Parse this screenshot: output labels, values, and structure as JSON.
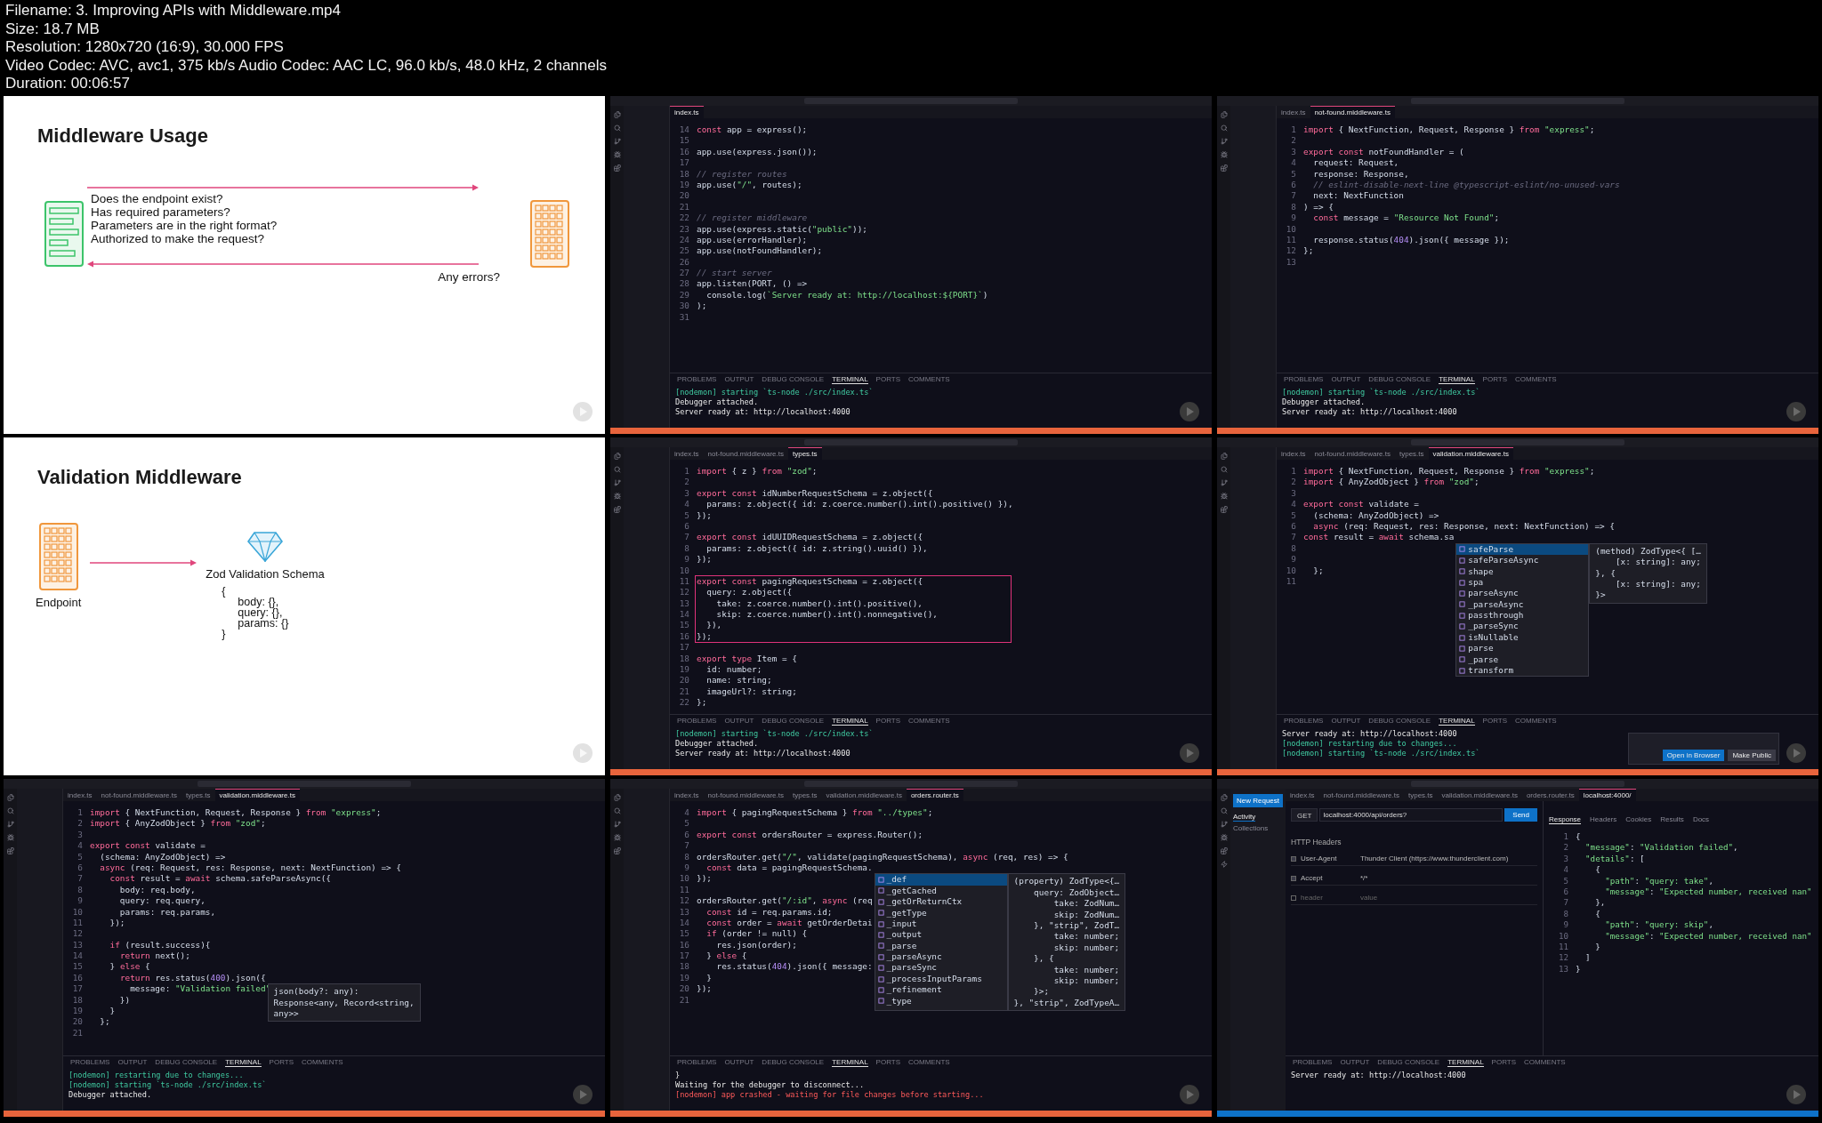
{
  "header": [
    "Filename: 3. Improving APIs with Middleware.mp4",
    "Size: 18.7 MB",
    "Resolution: 1280x720 (16:9), 30.000 FPS",
    "Video Codec: AVC, avc1, 375 kb/s Audio Codec: AAC LC, 96.0 kb/s, 48.0 kHz, 2 channels",
    "Duration: 00:06:57"
  ],
  "tiles": [
    {
      "kind": "flow_slide",
      "title": "Middleware Usage",
      "questions": [
        "Does the endpoint exist?",
        "Has required parameters?",
        "Parameters are in the right format?",
        "Authorized to make the request?"
      ],
      "caption": "Any errors?"
    },
    {
      "kind": "editor",
      "status_bar": {
        "color": "#e8643c"
      },
      "tabs": [
        {
          "label": "index.ts",
          "selected": true
        }
      ],
      "lines": [
        {
          "n": "14",
          "text": "const app = express();"
        },
        {
          "n": "15"
        },
        {
          "n": "16",
          "text": "app.use(express.json());"
        },
        {
          "n": "17"
        },
        {
          "n": "18",
          "text": "// register routes"
        },
        {
          "n": "19",
          "text": "app.use(\"/\", routes);"
        },
        {
          "n": "20"
        },
        {
          "n": "21"
        },
        {
          "n": "22",
          "text": "// register middleware"
        },
        {
          "n": "23",
          "text": "app.use(express.static(\"public\"));"
        },
        {
          "n": "24",
          "text": "app.use(errorHandler);"
        },
        {
          "n": "25",
          "text": "app.use(notFoundHandler);"
        },
        {
          "n": "26"
        },
        {
          "n": "27",
          "text": "// start server"
        },
        {
          "n": "28",
          "text": "app.listen(PORT, () =>"
        },
        {
          "n": "29",
          "text": "  console.log(`Server ready at: http://localhost:${PORT}`)"
        },
        {
          "n": "30",
          "text": ");"
        },
        {
          "n": "31"
        }
      ],
      "panel_tabs": [
        {
          "label": "PROBLEMS",
          "selected": false
        },
        {
          "label": "OUTPUT",
          "selected": false
        },
        {
          "label": "DEBUG CONSOLE",
          "selected": false
        },
        {
          "label": "TERMINAL",
          "selected": true
        },
        {
          "label": "PORTS",
          "selected": false
        },
        {
          "label": "COMMENTS",
          "selected": false
        }
      ],
      "terminal": [
        {
          "kind": "info",
          "text": "[nodemon] starting `ts-node ./src/index.ts`"
        },
        {
          "kind": "plain",
          "text": "Debugger attached."
        },
        {
          "kind": "plain",
          "text": "Server ready at: http://localhost:4000"
        }
      ]
    },
    {
      "kind": "editor",
      "status_bar": {
        "color": "#e8643c"
      },
      "tabs": [
        {
          "label": "index.ts",
          "selected": false
        },
        {
          "label": "not-found.middleware.ts",
          "selected": true
        }
      ],
      "lines": [
        {
          "n": "1",
          "text": "import { NextFunction, Request, Response } from \"express\";"
        },
        {
          "n": "2"
        },
        {
          "n": "3",
          "text": "export const notFoundHandler = ("
        },
        {
          "n": "4",
          "text": "  request: Request,"
        },
        {
          "n": "5",
          "text": "  response: Response,"
        },
        {
          "n": "6",
          "text": "  // eslint-disable-next-line @typescript-eslint/no-unused-vars"
        },
        {
          "n": "7",
          "text": "  next: NextFunction"
        },
        {
          "n": "8",
          "text": ") => {"
        },
        {
          "n": "9",
          "text": "  const message = \"Resource Not Found\";"
        },
        {
          "n": "10"
        },
        {
          "n": "11",
          "text": "  response.status(404).json({ message });"
        },
        {
          "n": "12",
          "text": "};"
        },
        {
          "n": "13"
        }
      ],
      "panel_tabs": [
        {
          "label": "PROBLEMS",
          "selected": false
        },
        {
          "label": "OUTPUT",
          "selected": false
        },
        {
          "label": "DEBUG CONSOLE",
          "selected": false
        },
        {
          "label": "TERMINAL",
          "selected": true
        },
        {
          "label": "PORTS",
          "selected": false
        },
        {
          "label": "COMMENTS",
          "selected": false
        }
      ],
      "terminal": [
        {
          "kind": "info",
          "text": "[nodemon] starting `ts-node ./src/index.ts`"
        },
        {
          "kind": "plain",
          "text": "Debugger attached."
        },
        {
          "kind": "plain",
          "text": "Server ready at: http://localhost:4000"
        }
      ]
    },
    {
      "kind": "schema_slide",
      "title": "Validation Middleware",
      "endpoint": "Endpoint",
      "schema": "Zod Validation Schema",
      "object_lines": [
        "{",
        "body: {},",
        "query: {},",
        "params: {}",
        "}"
      ]
    },
    {
      "kind": "editor",
      "status_bar": {
        "color": "#e8643c"
      },
      "tabs": [
        {
          "label": "index.ts",
          "selected": false
        },
        {
          "label": "not-found.middleware.ts",
          "selected": false
        },
        {
          "label": "types.ts",
          "selected": true
        }
      ],
      "lines": [
        {
          "n": "1",
          "text": "import { z } from \"zod\";"
        },
        {
          "n": "2"
        },
        {
          "n": "3",
          "text": "export const idNumberRequestSchema = z.object({"
        },
        {
          "n": "4",
          "text": "  params: z.object({ id: z.coerce.number().int().positive() }),"
        },
        {
          "n": "5",
          "text": "});"
        },
        {
          "n": "6"
        },
        {
          "n": "7",
          "text": "export const idUUIDRequestSchema = z.object({"
        },
        {
          "n": "8",
          "text": "  params: z.object({ id: z.string().uuid() }),"
        },
        {
          "n": "9",
          "text": "});"
        },
        {
          "n": "10"
        },
        {
          "n": "11",
          "text": "export const pagingRequestSchema = z.object({",
          "boxed": true
        },
        {
          "n": "12",
          "text": "  query: z.object({",
          "boxed": true
        },
        {
          "n": "13",
          "text": "    take: z.coerce.number().int().positive(),",
          "boxed": true
        },
        {
          "n": "14",
          "text": "    skip: z.coerce.number().int().nonnegative(),",
          "boxed": true
        },
        {
          "n": "15",
          "text": "  }),",
          "boxed": true
        },
        {
          "n": "16",
          "text": "});",
          "boxed": true
        },
        {
          "n": "17"
        },
        {
          "n": "18",
          "text": "export type Item = {"
        },
        {
          "n": "19",
          "text": "  id: number;"
        },
        {
          "n": "20",
          "text": "  name: string;"
        },
        {
          "n": "21",
          "text": "  imageUrl?: string;"
        },
        {
          "n": "22",
          "text": "};"
        }
      ],
      "panel_tabs": [
        {
          "label": "PROBLEMS",
          "selected": false
        },
        {
          "label": "OUTPUT",
          "selected": false
        },
        {
          "label": "DEBUG CONSOLE",
          "selected": false
        },
        {
          "label": "TERMINAL",
          "selected": true
        },
        {
          "label": "PORTS",
          "selected": false
        },
        {
          "label": "COMMENTS",
          "selected": false
        }
      ],
      "terminal": [
        {
          "kind": "info",
          "text": "[nodemon] starting `ts-node ./src/index.ts`"
        },
        {
          "kind": "plain",
          "text": "Debugger attached."
        },
        {
          "kind": "plain",
          "text": "Server ready at: http://localhost:4000"
        }
      ]
    },
    {
      "kind": "editor",
      "status_bar": {
        "color": "#e8643c"
      },
      "tabs": [
        {
          "label": "index.ts",
          "selected": false
        },
        {
          "label": "not-found.middleware.ts",
          "selected": false
        },
        {
          "label": "types.ts",
          "selected": false
        },
        {
          "label": "validation.middleware.ts",
          "selected": true
        }
      ],
      "lines": [
        {
          "n": "1",
          "text": "import { NextFunction, Request, Response } from \"express\";"
        },
        {
          "n": "2",
          "text": "import { AnyZodObject } from \"zod\";"
        },
        {
          "n": "3"
        },
        {
          "n": "4",
          "text": "export const validate ="
        },
        {
          "n": "5",
          "text": "  (schema: AnyZodObject) =>"
        },
        {
          "n": "6",
          "text": "  async (req: Request, res: Response, next: NextFunction) => {"
        },
        {
          "n": "7",
          "text": "const result = await schema.sa",
          "popup": {
            "kind": "completion",
            "items": [
              {
                "label": "safeParse",
                "selected": true
              },
              {
                "label": "safeParseAsync",
                "selected": false
              },
              {
                "label": "shape",
                "selected": false
              },
              {
                "label": "spa",
                "selected": false
              },
              {
                "label": "parseAsync",
                "selected": false
              },
              {
                "label": "_parseAsync",
                "selected": false
              },
              {
                "label": "passthrough",
                "selected": false
              },
              {
                "label": "_parseSync",
                "selected": false
              },
              {
                "label": "isNullable",
                "selected": false
              },
              {
                "label": "parse",
                "selected": false
              },
              {
                "label": "_parse",
                "selected": false
              },
              {
                "label": "transform",
                "selected": false
              }
            ],
            "detail": [
              "(method) ZodType<{ […",
              "    [x: string]: any;",
              "}, {",
              "    [x: string]: any;",
              "}>"
            ]
          }
        },
        {
          "n": "8"
        },
        {
          "n": "9"
        },
        {
          "n": "10",
          "text": "  };"
        },
        {
          "n": "11"
        }
      ],
      "panel_tabs": [
        {
          "label": "PROBLEMS",
          "selected": false
        },
        {
          "label": "OUTPUT",
          "selected": false
        },
        {
          "label": "DEBUG CONSOLE",
          "selected": false
        },
        {
          "label": "TERMINAL",
          "selected": true
        },
        {
          "label": "PORTS",
          "selected": false
        },
        {
          "label": "COMMENTS",
          "selected": false
        }
      ],
      "terminal": [
        {
          "kind": "plain",
          "text": "Server ready at: http://localhost:4000"
        },
        {
          "kind": "info",
          "text": "[nodemon] restarting due to changes..."
        },
        {
          "kind": "info",
          "text": "[nodemon] starting `ts-node ./src/index.ts`"
        }
      ],
      "toast": {
        "buttons": [
          "Open in Browser",
          "Make Public"
        ]
      }
    },
    {
      "kind": "editor",
      "status_bar": {
        "color": "#e8643c"
      },
      "tabs": [
        {
          "label": "index.ts",
          "selected": false
        },
        {
          "label": "not-found.middleware.ts",
          "selected": false
        },
        {
          "label": "types.ts",
          "selected": false
        },
        {
          "label": "validation.middleware.ts",
          "selected": true
        }
      ],
      "lines": [
        {
          "n": "1",
          "text": "import { NextFunction, Request, Response } from \"express\";"
        },
        {
          "n": "2",
          "text": "import { AnyZodObject } from \"zod\";"
        },
        {
          "n": "3"
        },
        {
          "n": "4",
          "text": "export const validate ="
        },
        {
          "n": "5",
          "text": "  (schema: AnyZodObject) =>"
        },
        {
          "n": "6",
          "text": "  async (req: Request, res: Response, next: NextFunction) => {"
        },
        {
          "n": "7",
          "text": "    const result = await schema.safeParseAsync({"
        },
        {
          "n": "8",
          "text": "      body: req.body,"
        },
        {
          "n": "9",
          "text": "      query: req.query,"
        },
        {
          "n": "10",
          "text": "      params: req.params,"
        },
        {
          "n": "11",
          "text": "    });"
        },
        {
          "n": "12"
        },
        {
          "n": "13",
          "text": "    if (result.success){"
        },
        {
          "n": "14",
          "text": "      return next();"
        },
        {
          "n": "15",
          "text": "    } else {"
        },
        {
          "n": "16",
          "text": "      return res.status(400).json({",
          "popup": {
            "kind": "hint",
            "detail": [
              "json(body?: any):",
              "Response<any, Record<string,",
              "any>>"
            ]
          }
        },
        {
          "n": "17",
          "text": "        message: \"Validation failed\""
        },
        {
          "n": "18",
          "text": "      })"
        },
        {
          "n": "19",
          "text": "    }"
        },
        {
          "n": "20",
          "text": "  };"
        },
        {
          "n": "21"
        }
      ],
      "panel_tabs": [
        {
          "label": "PROBLEMS",
          "selected": false
        },
        {
          "label": "OUTPUT",
          "selected": false
        },
        {
          "label": "DEBUG CONSOLE",
          "selected": false
        },
        {
          "label": "TERMINAL",
          "selected": true
        },
        {
          "label": "PORTS",
          "selected": false
        },
        {
          "label": "COMMENTS",
          "selected": false
        }
      ],
      "terminal": [
        {
          "kind": "info",
          "text": "[nodemon] restarting due to changes..."
        },
        {
          "kind": "info",
          "text": "[nodemon] starting `ts-node ./src/index.ts`"
        },
        {
          "kind": "plain",
          "text": "Debugger attached."
        }
      ]
    },
    {
      "kind": "editor",
      "status_bar": {
        "color": "#e8643c"
      },
      "tabs": [
        {
          "label": "index.ts",
          "selected": false
        },
        {
          "label": "not-found.middleware.ts",
          "selected": false
        },
        {
          "label": "types.ts",
          "selected": false
        },
        {
          "label": "validation.middleware.ts",
          "selected": false
        },
        {
          "label": "orders.router.ts",
          "selected": true
        }
      ],
      "lines": [
        {
          "n": "4",
          "text": "import { pagingRequestSchema } from \"../types\";"
        },
        {
          "n": "5"
        },
        {
          "n": "6",
          "text": "export const ordersRouter = express.Router();"
        },
        {
          "n": "7"
        },
        {
          "n": "8",
          "text": "ordersRouter.get(\"/\", validate(pagingRequestSchema), async (req, res) => {"
        },
        {
          "n": "9",
          "text": "  const data = pagingRequestSchema.",
          "popup": {
            "kind": "completion",
            "items": [
              {
                "label": "_def",
                "selected": true
              },
              {
                "label": "_getCached",
                "selected": false
              },
              {
                "label": "_getOrReturnCtx",
                "selected": false
              },
              {
                "label": "_getType",
                "selected": false
              },
              {
                "label": "_input",
                "selected": false
              },
              {
                "label": "_output",
                "selected": false
              },
              {
                "label": "_parse",
                "selected": false
              },
              {
                "label": "_parseAsync",
                "selected": false
              },
              {
                "label": "_parseSync",
                "selected": false
              },
              {
                "label": "_processInputParams",
                "selected": false
              },
              {
                "label": "_refinement",
                "selected": false
              },
              {
                "label": "_type",
                "selected": false
              }
            ],
            "detail": [
              "(property) ZodType<{…",
              "    query: ZodObject…",
              "        take: ZodNum…",
              "        skip: ZodNum…",
              "    }, \"strip\", ZodT…",
              "        take: number;",
              "        skip: number;",
              "    }, {",
              "        take: number;",
              "        skip: number;",
              "    }>;",
              "}, \"strip\", ZodTypeA…"
            ]
          }
        },
        {
          "n": "10",
          "text": "});"
        },
        {
          "n": "11"
        },
        {
          "n": "12",
          "text": "ordersRouter.get(\"/:id\", async (req"
        },
        {
          "n": "13",
          "text": "  const id = req.params.id;"
        },
        {
          "n": "14",
          "text": "  const order = await getOrderDetai"
        },
        {
          "n": "15",
          "text": "  if (order != null) {"
        },
        {
          "n": "16",
          "text": "    res.json(order);"
        },
        {
          "n": "17",
          "text": "  } else {"
        },
        {
          "n": "18",
          "text": "    res.status(404).json({ message:"
        },
        {
          "n": "19",
          "text": "  }"
        },
        {
          "n": "20",
          "text": "});"
        },
        {
          "n": "21"
        }
      ],
      "panel_tabs": [
        {
          "label": "PROBLEMS",
          "selected": false
        },
        {
          "label": "OUTPUT",
          "selected": false
        },
        {
          "label": "DEBUG CONSOLE",
          "selected": false
        },
        {
          "label": "TERMINAL",
          "selected": true
        },
        {
          "label": "PORTS",
          "selected": false
        },
        {
          "label": "COMMENTS",
          "selected": false
        }
      ],
      "terminal": [
        {
          "kind": "plain",
          "text": "}"
        },
        {
          "kind": "plain",
          "text": "Waiting for the debugger to disconnect..."
        },
        {
          "kind": "error",
          "text": "[nodemon] app crashed - waiting for file changes before starting..."
        }
      ]
    },
    {
      "kind": "client",
      "status_bar": {
        "color": "#0e72c8"
      },
      "tabs": [
        {
          "label": "index.ts",
          "selected": false
        },
        {
          "label": "not-found.middleware.ts",
          "selected": false
        },
        {
          "label": "types.ts",
          "selected": false
        },
        {
          "label": "validation.middleware.ts",
          "selected": false
        },
        {
          "label": "orders.router.ts",
          "selected": false
        },
        {
          "label": "localhost:4000/",
          "selected": true
        }
      ],
      "new_request": "New Request",
      "sidebar_tabs": [
        {
          "label": "Activity",
          "selected": true
        },
        {
          "label": "Collections",
          "selected": false
        }
      ],
      "method": "GET",
      "url": "localhost:4000/api/orders?",
      "send": "Send",
      "headers_title": "HTTP Headers",
      "headers": [
        {
          "name": "User-Agent",
          "value": "Thunder Client (https://www.thunderclient.com)",
          "checked": true
        },
        {
          "name": "Accept",
          "value": "*/*",
          "checked": true
        },
        {
          "name_placeholder": "header",
          "value_placeholder": "value",
          "checked": false
        }
      ],
      "response_tabs": [
        {
          "label": "Response",
          "selected": true
        },
        {
          "label": "Headers",
          "selected": false
        },
        {
          "label": "Cookies",
          "selected": false
        },
        {
          "label": "Results",
          "selected": false
        },
        {
          "label": "Docs",
          "selected": false
        }
      ],
      "response": [
        {
          "n": "1",
          "text": "{"
        },
        {
          "n": "2",
          "text": "  \"message\": \"Validation failed\","
        },
        {
          "n": "3",
          "text": "  \"details\": ["
        },
        {
          "n": "4",
          "text": "    {"
        },
        {
          "n": "5",
          "text": "      \"path\": \"query: take\","
        },
        {
          "n": "6",
          "text": "      \"message\": \"Expected number, received nan\""
        },
        {
          "n": "7",
          "text": "    },"
        },
        {
          "n": "8",
          "text": "    {"
        },
        {
          "n": "9",
          "text": "      \"path\": \"query: skip\","
        },
        {
          "n": "10",
          "text": "      \"message\": \"Expected number, received nan\""
        },
        {
          "n": "11",
          "text": "    }"
        },
        {
          "n": "12",
          "text": "  ]"
        },
        {
          "n": "13",
          "text": "}"
        }
      ],
      "panel_tabs": [
        {
          "label": "PROBLEMS",
          "selected": false
        },
        {
          "label": "OUTPUT",
          "selected": false
        },
        {
          "label": "DEBUG CONSOLE",
          "selected": false
        },
        {
          "label": "TERMINAL",
          "selected": true
        },
        {
          "label": "PORTS",
          "selected": false
        },
        {
          "label": "COMMENTS",
          "selected": false
        }
      ],
      "terminal": [
        {
          "kind": "plain",
          "text": "Server ready at: http://localhost:4000"
        }
      ]
    }
  ]
}
